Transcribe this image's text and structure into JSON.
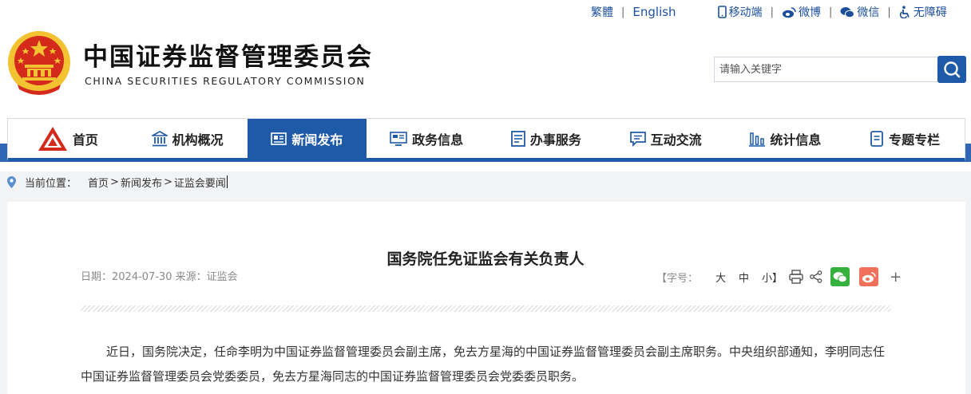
{
  "top_links": {
    "traditional": "繁體",
    "english": "English",
    "mobile": "移动端",
    "weibo": "微博",
    "wechat": "微信",
    "accessibility": "无障碍"
  },
  "header": {
    "title_cn": "中国证券监督管理委员会",
    "title_en": "CHINA SECURITIES REGULATORY COMMISSION"
  },
  "search": {
    "placeholder": "请输入关键字"
  },
  "nav": {
    "items": [
      {
        "label": "首页",
        "icon": "csrc-logo-icon"
      },
      {
        "label": "机构概况",
        "icon": "building-icon"
      },
      {
        "label": "新闻发布",
        "icon": "newspaper-icon",
        "active": true
      },
      {
        "label": "政务信息",
        "icon": "monitor-icon"
      },
      {
        "label": "办事服务",
        "icon": "document-list-icon"
      },
      {
        "label": "互动交流",
        "icon": "chat-icon"
      },
      {
        "label": "统计信息",
        "icon": "bar-chart-icon"
      },
      {
        "label": "专题专栏",
        "icon": "notebook-icon"
      }
    ]
  },
  "breadcrumb": {
    "label": "当前位置：",
    "items": [
      "首页",
      "新闻发布",
      "证监会要闻"
    ],
    "sep": ">"
  },
  "article": {
    "title": "国务院任免证监会有关负责人",
    "meta": "日期：2024-07-30 来源：证监会",
    "font_size_label": "【字号：",
    "font_sizes": [
      "大",
      "中",
      "小】"
    ],
    "plus": "+",
    "body": "近日，国务院决定，任命李明为中国证券监督管理委员会副主席，免去方星海的中国证券监督管理委员会副主席职务。中央组织部通知，李明同志任中国证券监督管理委员会党委委员，免去方星海同志的中国证券监督管理委员会党委委员职务。"
  },
  "colors": {
    "brand_blue": "#1f5aa8",
    "wechat_green": "#37b13d",
    "weibo_red": "#f0705c",
    "emblem_red": "#d42a1c",
    "emblem_gold": "#f2c230"
  }
}
